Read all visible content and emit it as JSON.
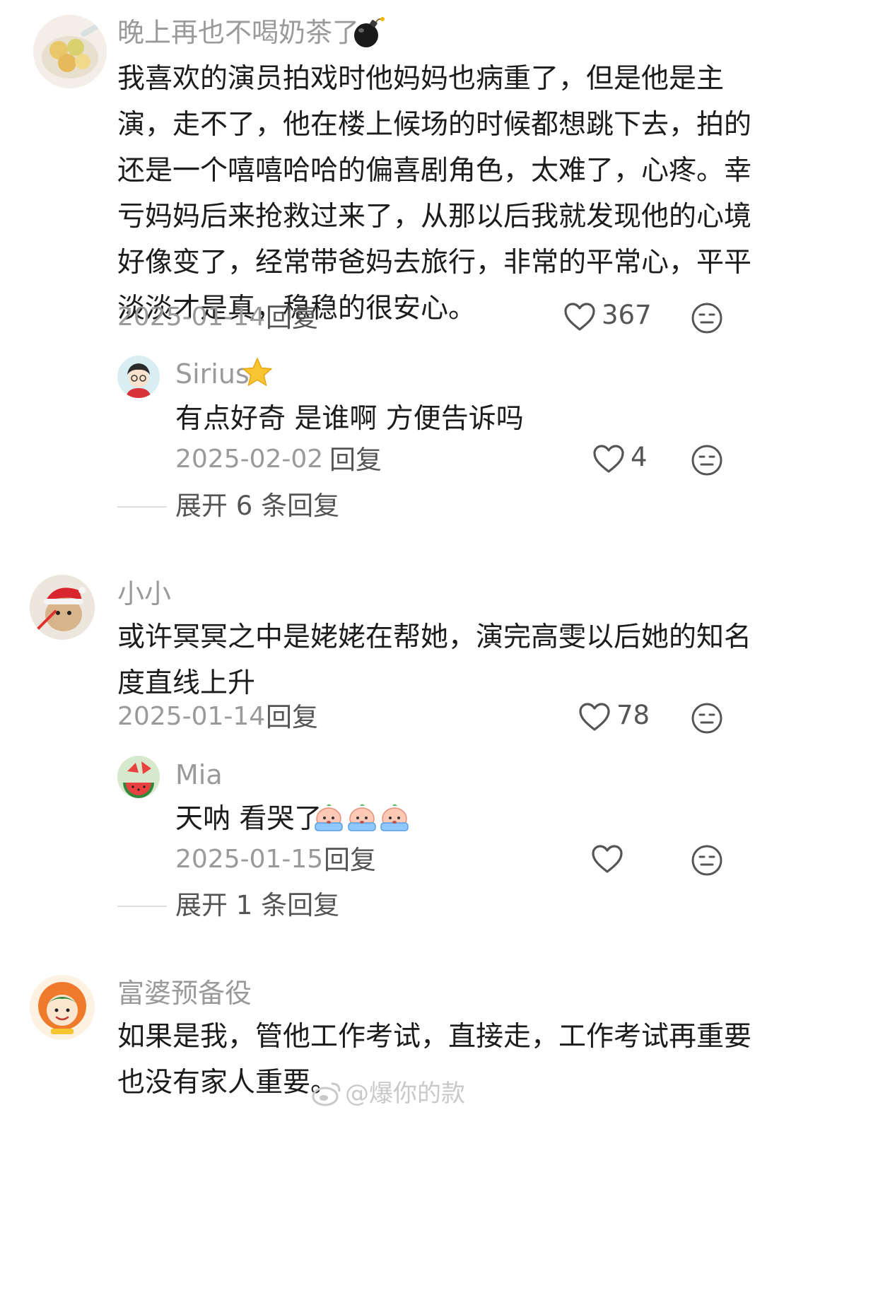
{
  "comments": [
    {
      "username": "晚上再也不喝奶茶了",
      "username_emoji": "bomb-emoji",
      "lines": [
        "我喜欢的演员拍戏时他妈妈也病重了，但是他是主",
        "演，走不了，他在楼上候场的时候都想跳下去，拍的",
        "还是一个嘻嘻哈哈的偏喜剧角色，太难了，心疼。幸",
        "亏妈妈后来抢救过来了，从那以后我就发现他的心境",
        "好像变了，经常带爸妈去旅行，非常的平常心，平平",
        "淡淡才是真，稳稳的很安心。"
      ],
      "date": "2025-01-14",
      "reply_label": "回复",
      "like_count": "367",
      "replies": [
        {
          "username": "Sirius",
          "username_emoji": "star-emoji",
          "text": "有点好奇 是谁啊 方便告诉吗",
          "date": "2025-02-02",
          "reply_label": "回复",
          "like_count": "4"
        }
      ],
      "expand_label": "展开 6 条回复"
    },
    {
      "username": "小小",
      "lines": [
        "或许冥冥之中是姥姥在帮她，演完高雯以后她的知名",
        "度直线上升"
      ],
      "date": "2025-01-14",
      "reply_label": "回复",
      "like_count": "78",
      "replies": [
        {
          "username": "Mia",
          "text": "天呐 看哭了",
          "text_emoji": [
            "crying-peach-emoji",
            "crying-peach-emoji",
            "crying-peach-emoji"
          ],
          "date": "2025-01-15",
          "reply_label": "回复",
          "like_count": ""
        }
      ],
      "expand_label": "展开 1 条回复"
    },
    {
      "username": "富婆预备役",
      "lines": [
        "如果是我，管他工作考试，直接走，工作考试再重要",
        "也没有家人重要。"
      ]
    }
  ],
  "watermark": "@爆你的款",
  "colors": {
    "username": "#9a9a9a",
    "body": "#1c1c1c",
    "secondary": "#555555",
    "divider": "#dedede"
  }
}
